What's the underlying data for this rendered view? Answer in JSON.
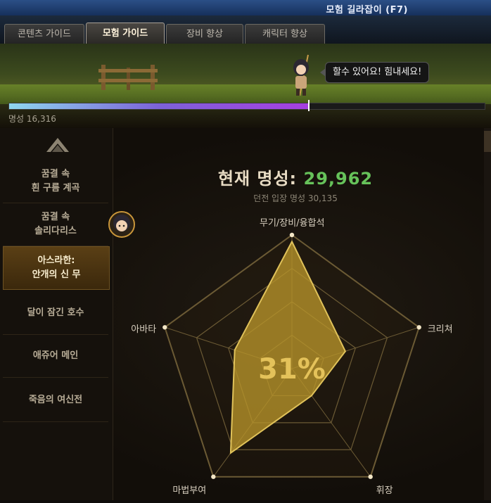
{
  "window": {
    "title": "모험 길라잡이 (F7)"
  },
  "tabs": [
    {
      "label": "콘텐츠 가이드",
      "active": false
    },
    {
      "label": "모험 가이드",
      "active": true
    },
    {
      "label": "장비 향상",
      "active": false
    },
    {
      "label": "캐릭터 향상",
      "active": false
    }
  ],
  "banner": {
    "speech": "할수 있어요! 힘내세요!",
    "progress": 0.63,
    "fame_label": "명성 16,316"
  },
  "sidebar": {
    "items": [
      {
        "label": "꿈결 속\n흰 구름 계곡",
        "active": false
      },
      {
        "label": "꿈결 속\n솔리다리스",
        "active": false
      },
      {
        "label": "아스라한:\n안개의 신 무",
        "active": true
      },
      {
        "label": "달이 잠긴 호수",
        "active": false
      },
      {
        "label": "애쥬어 메인",
        "active": false
      },
      {
        "label": "죽음의 여신전",
        "active": false
      }
    ]
  },
  "main": {
    "current_fame_label": "현재 명성:",
    "current_fame_value": "29,962",
    "dungeon_fame": "던전 입장 명성 30,135"
  },
  "chart_data": {
    "type": "radar",
    "axes": [
      "무기/장비/융합석",
      "크리쳐",
      "휘장",
      "마법부여",
      "아바타"
    ],
    "values": [
      0.95,
      0.42,
      0.25,
      0.78,
      0.45
    ],
    "center_label": "31%",
    "range": [
      0,
      1
    ],
    "colors": {
      "fill": "#b8952a",
      "grid": "#6b5a34"
    }
  },
  "colors": {
    "accent": "#66c25a",
    "active_item": "#5a3f15"
  }
}
